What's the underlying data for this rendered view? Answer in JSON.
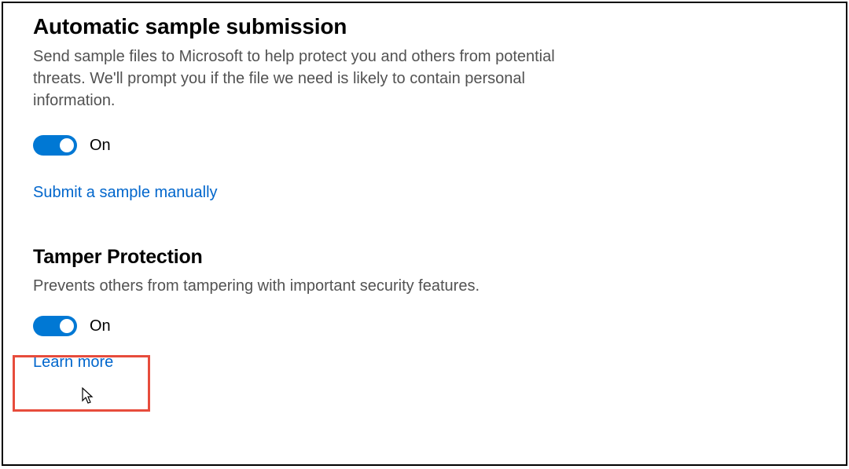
{
  "sections": {
    "sample_submission": {
      "title": "Automatic sample submission",
      "description": "Send sample files to Microsoft to help protect you and others from potential threats. We'll prompt you if the file we need is likely to contain personal information.",
      "toggle_state": "On",
      "link_text": "Submit a sample manually"
    },
    "tamper_protection": {
      "title": "Tamper Protection",
      "description": "Prevents others from tampering with important security features.",
      "toggle_state": "On",
      "link_text": "Learn more"
    }
  },
  "colors": {
    "accent": "#0078d4",
    "link": "#0066cc",
    "highlight": "#e74c3c",
    "text_secondary": "#525252"
  }
}
